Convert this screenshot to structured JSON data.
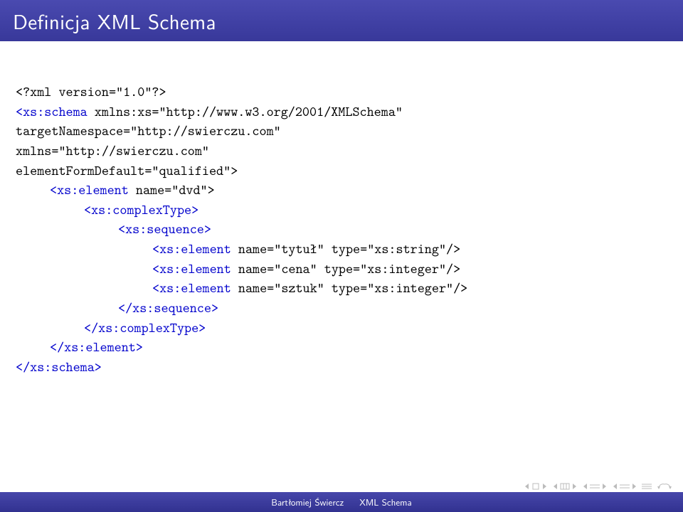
{
  "slide": {
    "title": "Definicja XML Schema"
  },
  "code": {
    "l1": "<?xml version=\"1.0\"?>",
    "l2a": "<xs:schema",
    "l2b": " xmlns:xs=\"http://www.w3.org/2001/XMLSchema\"",
    "l3": "targetNamespace=\"http://swierczu.com\"",
    "l4": "xmlns=\"http://swierczu.com\"",
    "l5": "elementFormDefault=\"qualified\">",
    "l6a": "<xs:element",
    "l6b": " name=\"dvd\">",
    "l7": "<xs:complexType>",
    "l8": "<xs:sequence>",
    "l9a": "<xs:element",
    "l9b": " name=\"tytuł\" type=\"xs:string\"/>",
    "l10a": "<xs:element",
    "l10b": " name=\"cena\" type=\"xs:integer\"/>",
    "l11a": "<xs:element",
    "l11b": " name=\"sztuk\" type=\"xs:integer\"/>",
    "l12": "</xs:sequence>",
    "l13": "</xs:complexType>",
    "l14": "</xs:element>",
    "l15": "</xs:schema>"
  },
  "footer": {
    "author": "Bartłomiej Świercz",
    "topic": "XML Schema"
  }
}
